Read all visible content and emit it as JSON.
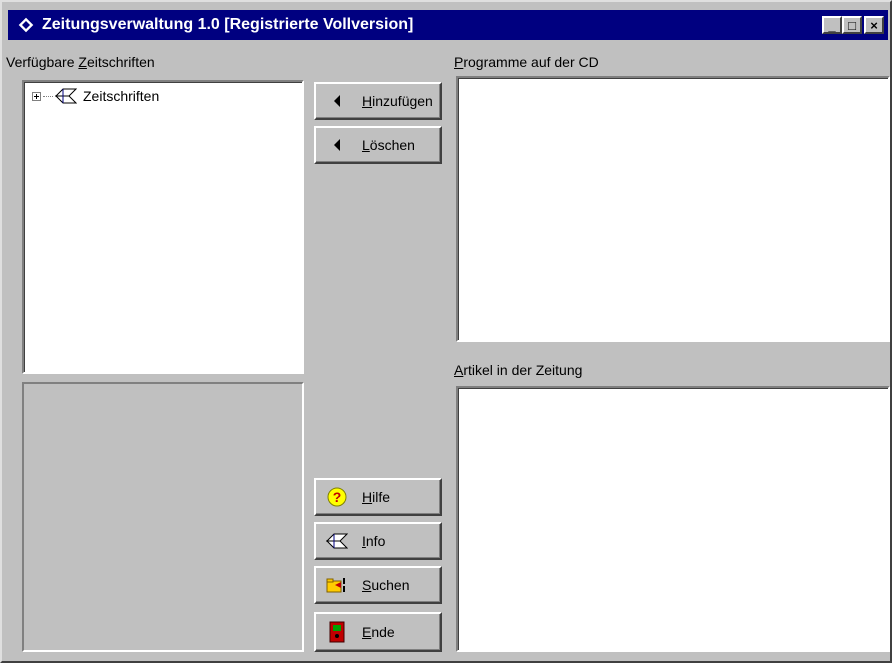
{
  "window": {
    "title": "Zeitungsverwaltung 1.0 [Registrierte Vollversion]",
    "controls": {
      "minimize": "_",
      "maximize": "□",
      "close": "×"
    }
  },
  "left": {
    "label_pre": "Verfügbare ",
    "label_accel": "Z",
    "label_post": "eitschriften",
    "tree": [
      {
        "label": "Zeitschriften",
        "icon": "diamond-book-icon",
        "expanded": false
      }
    ]
  },
  "right_top": {
    "label_accel": "P",
    "label_post": "rogramme auf der CD"
  },
  "right_bottom": {
    "label_accel": "A",
    "label_post": "rtikel in der Zeitung"
  },
  "buttons": {
    "add": {
      "accel": "H",
      "rest": "inzufügen",
      "icon": "arrow-left-icon"
    },
    "delete": {
      "accel": "L",
      "rest": "öschen",
      "icon": "arrow-left-icon"
    },
    "help": {
      "accel": "H",
      "rest": "ilfe",
      "icon": "question-icon"
    },
    "info": {
      "accel": "I",
      "rest": "nfo",
      "icon": "diamond-book-icon"
    },
    "search": {
      "accel": "S",
      "rest": "uchen",
      "icon": "folder-search-icon"
    },
    "exit": {
      "accel": "E",
      "rest": "nde",
      "icon": "exit-door-icon"
    }
  },
  "colors": {
    "titlebar": "#000080",
    "face": "#c0c0c0",
    "window": "#ffffff"
  }
}
